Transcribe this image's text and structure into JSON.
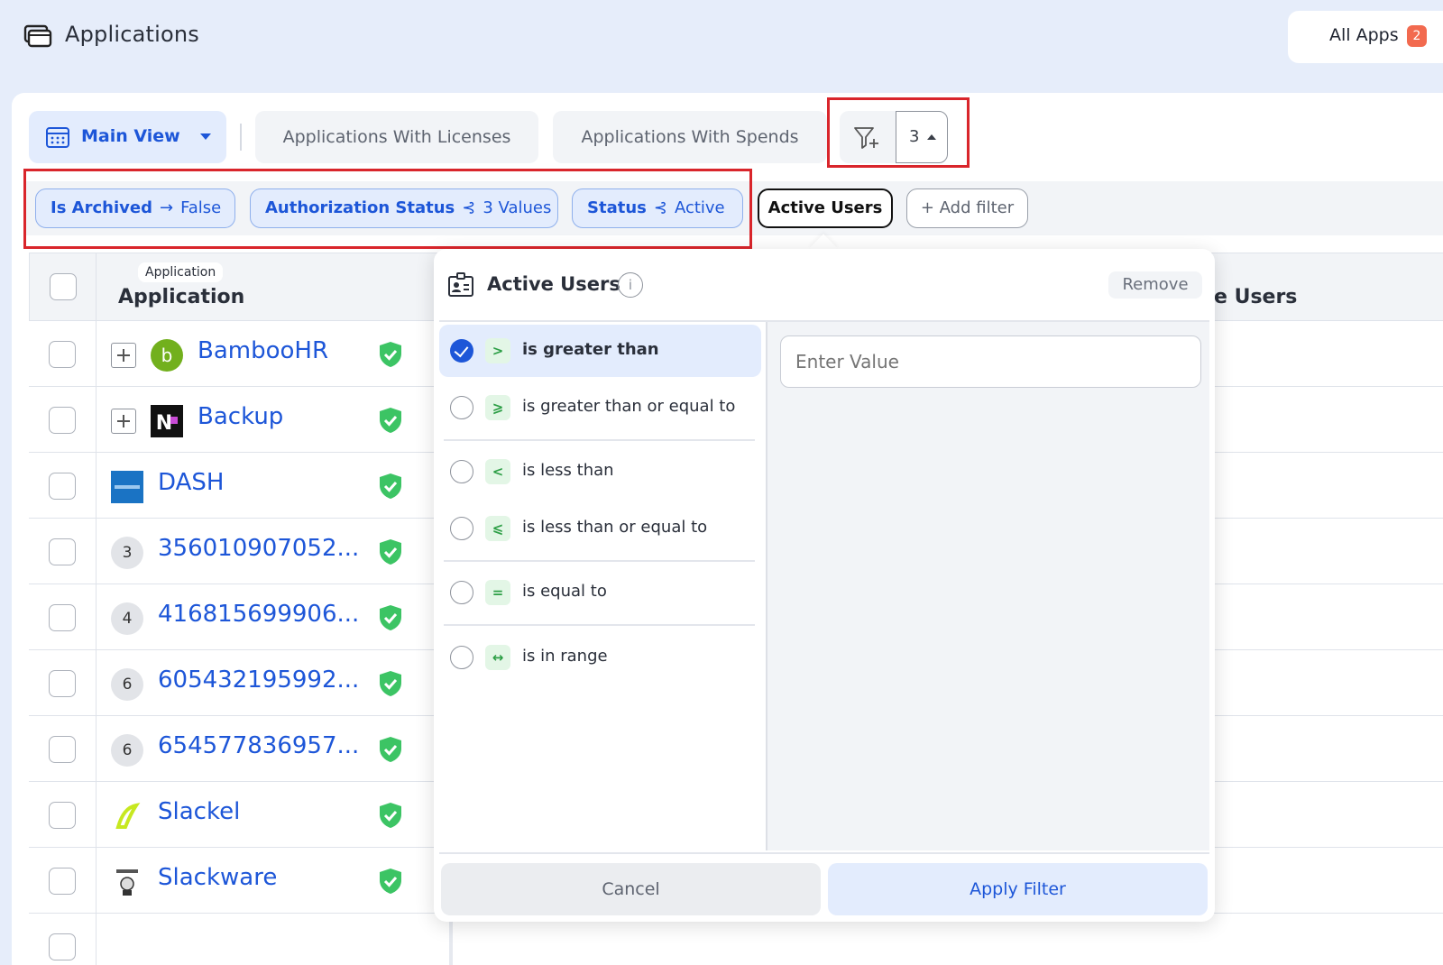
{
  "header": {
    "title": "Applications",
    "all_apps_label": "All Apps",
    "all_apps_badge": "2"
  },
  "views": {
    "main_view_label": "Main View",
    "tabs": [
      "Applications With Licenses",
      "Applications With Spends"
    ],
    "filter_count": "3"
  },
  "filters": {
    "chips": [
      {
        "key": "Is Archived",
        "op": "→",
        "value": "False"
      },
      {
        "key": "Authorization Status",
        "op": "⊰",
        "value": "3 Values"
      },
      {
        "key": "Status",
        "op": "⊰",
        "value": "Active"
      }
    ],
    "active_chip": "Active Users",
    "add_filter": "+ Add filter"
  },
  "table": {
    "header_tag": "Application",
    "header_title": "Application",
    "header_right": "e Users",
    "rows": [
      {
        "name": "BambooHR",
        "logo": "bamboohr-logo",
        "expandable": true
      },
      {
        "name": "Backup",
        "logo": "backup-logo",
        "expandable": true
      },
      {
        "name": "DASH",
        "logo": "dash-logo",
        "expandable": false
      },
      {
        "name": "356010907052...",
        "badge": "3",
        "expandable": false
      },
      {
        "name": "416815699906...",
        "badge": "4",
        "expandable": false
      },
      {
        "name": "605432195992...",
        "badge": "6",
        "expandable": false
      },
      {
        "name": "654577836957...",
        "badge": "6",
        "expandable": false
      },
      {
        "name": "Slackel",
        "logo": "slackel-logo",
        "expandable": false
      },
      {
        "name": "Slackware",
        "logo": "slackware-logo",
        "expandable": false
      }
    ]
  },
  "popover": {
    "title": "Active Users",
    "remove_label": "Remove",
    "value_placeholder": "Enter Value",
    "options": [
      {
        "symbol": ">",
        "label": "is greater than",
        "selected": true
      },
      {
        "symbol": "⩾",
        "label": "is greater than or equal to",
        "selected": false
      },
      {
        "symbol": "<",
        "label": "is less than",
        "selected": false
      },
      {
        "symbol": "⩽",
        "label": "is less than or equal to",
        "selected": false
      },
      {
        "symbol": "=",
        "label": "is equal to",
        "selected": false
      },
      {
        "symbol": "↔",
        "label": "is in range",
        "selected": false
      }
    ],
    "cancel_label": "Cancel",
    "apply_label": "Apply Filter"
  },
  "colors": {
    "accent": "#1d56d8",
    "highlight_box": "#d9252b",
    "shield_green": "#3cc464",
    "page_bg": "#e6edfa"
  }
}
